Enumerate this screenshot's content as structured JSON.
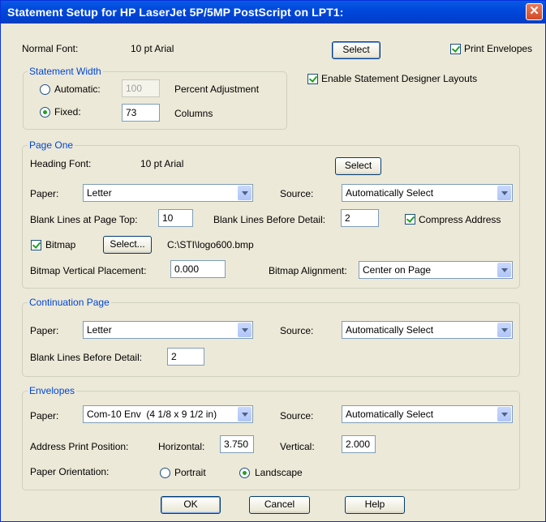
{
  "window": {
    "title": "Statement Setup for HP LaserJet 5P/5MP PostScript on LPT1:",
    "close_glyph": "✕"
  },
  "top": {
    "normal_font_label": "Normal Font:",
    "normal_font_value": "10 pt Arial",
    "select_label": "Select",
    "print_envelopes_label": "Print Envelopes",
    "print_envelopes_checked": true,
    "enable_designer_label": "Enable Statement Designer Layouts",
    "enable_designer_checked": true
  },
  "statement_width": {
    "legend": "Statement Width",
    "automatic_label": "Automatic:",
    "automatic_value": "100",
    "percent_label": "Percent Adjustment",
    "fixed_label": "Fixed:",
    "fixed_value": "73",
    "columns_label": "Columns",
    "selected": "fixed"
  },
  "page_one": {
    "legend": "Page One",
    "heading_font_label": "Heading Font:",
    "heading_font_value": "10 pt Arial",
    "select_label": "Select",
    "paper_label": "Paper:",
    "paper_value": "Letter",
    "source_label": "Source:",
    "source_value": "Automatically Select",
    "blank_top_label": "Blank Lines at Page Top:",
    "blank_top_value": "10",
    "blank_before_label": "Blank Lines Before Detail:",
    "blank_before_value": "2",
    "compress_label": "Compress Address",
    "compress_checked": true,
    "bitmap_label": "Bitmap",
    "bitmap_checked": true,
    "bitmap_select_label": "Select...",
    "bitmap_path": "C:\\STI\\logo600.bmp",
    "vertical_placement_label": "Bitmap Vertical Placement:",
    "vertical_placement_value": "0.000",
    "alignment_label": "Bitmap Alignment:",
    "alignment_value": "Center on Page"
  },
  "continuation": {
    "legend": "Continuation Page",
    "paper_label": "Paper:",
    "paper_value": "Letter",
    "source_label": "Source:",
    "source_value": "Automatically Select",
    "blank_before_label": "Blank Lines Before Detail:",
    "blank_before_value": "2"
  },
  "envelopes": {
    "legend": "Envelopes",
    "paper_label": "Paper:",
    "paper_value": "Com-10 Env  (4 1/8 x 9 1/2 in)",
    "source_label": "Source:",
    "source_value": "Automatically Select",
    "address_position_label": "Address Print Position:",
    "horizontal_label": "Horizontal:",
    "horizontal_value": "3.750",
    "vertical_label": "Vertical:",
    "vertical_value": "2.000",
    "orientation_label": "Paper Orientation:",
    "portrait_label": "Portrait",
    "landscape_label": "Landscape",
    "selected_orientation": "landscape"
  },
  "footer": {
    "ok_label": "OK",
    "cancel_label": "Cancel",
    "help_label": "Help"
  }
}
